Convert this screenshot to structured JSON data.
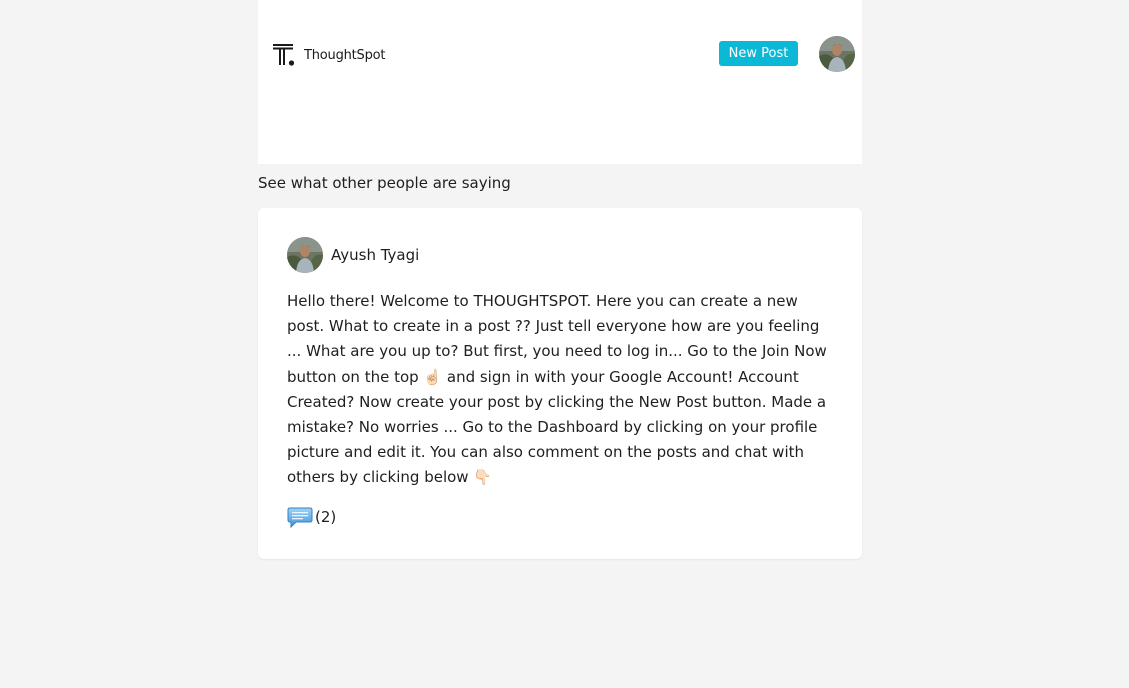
{
  "header": {
    "logo_text": "ThoughtSpot",
    "new_post_label": "New Post",
    "accent_color": "#0bb8d6"
  },
  "feed": {
    "section_title": "See what other people are saying"
  },
  "post": {
    "author": "Ayush Tyagi",
    "body": "Hello there! Welcome to THOUGHTSPOT. Here you can create a new post. What to create in a post ?? Just tell everyone how are you feeling ... What are you up to? But first, you need to log in... Go to the Join Now button on the top ☝🏻 and sign in with your Google Account! Account Created? Now create your post by clicking the New Post button. Made a mistake? No worries ... Go to the Dashboard by clicking on your profile picture and edit it. You can also comment on the posts and chat with others by clicking below 👇🏻",
    "comment_count": "(2)",
    "comment_icon": "speech-bubble-icon"
  }
}
